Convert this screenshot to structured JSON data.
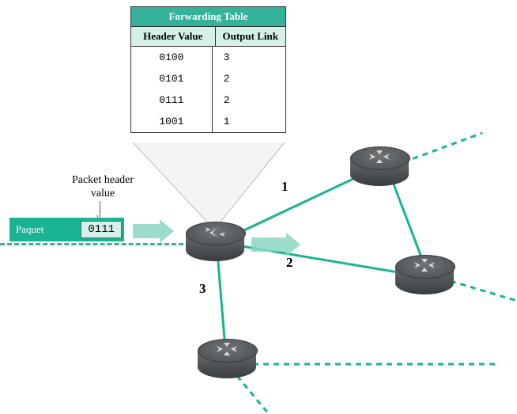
{
  "table": {
    "title": "Forwarding Table",
    "col1": "Header Value",
    "col2": "Output Link",
    "rows": [
      {
        "hv": "0100",
        "ol": "3"
      },
      {
        "hv": "0101",
        "ol": "2"
      },
      {
        "hv": "0111",
        "ol": "2"
      },
      {
        "hv": "1001",
        "ol": "1"
      }
    ]
  },
  "packet": {
    "caption": "Packet header value",
    "label": "Paquet",
    "header_value": "0111"
  },
  "links": {
    "l1": "1",
    "l2": "2",
    "l3": "3"
  },
  "colors": {
    "teal": "#35b29a",
    "light": "#8dd6c5"
  }
}
